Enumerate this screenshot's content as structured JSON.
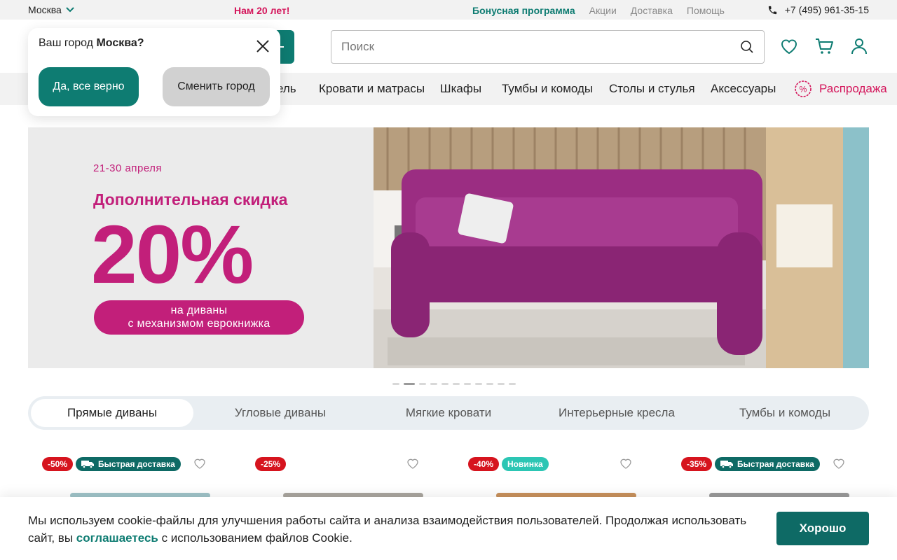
{
  "topbar": {
    "city": "Москва",
    "anniversary": "Нам 20 лет!",
    "links": [
      "Бонусная программа",
      "Акции",
      "Доставка",
      "Помощь"
    ],
    "phone": "+7 (495) 961-35-15"
  },
  "header": {
    "search_placeholder": "Поиск",
    "icons": [
      "heart-icon",
      "cart-icon",
      "user-icon"
    ]
  },
  "nav": {
    "partial_item": "ель",
    "items": [
      "Кровати и матрасы",
      "Шкафы",
      "Тумбы и комоды",
      "Столы и стулья",
      "Аксессуары"
    ],
    "sale": "Распродажа"
  },
  "city_popup": {
    "question": "Ваш город",
    "city": "Москва?",
    "confirm": "Да, все верно",
    "change": "Сменить город"
  },
  "banner": {
    "date": "21-30 апреля",
    "headline": "Дополнительная скидка",
    "percent": "20%",
    "pill_line1": "на диваны",
    "pill_line2": "с механизмом еврокнижка",
    "slides_total": 11,
    "active_slide": 2
  },
  "category_tabs": [
    {
      "label": "Прямые диваны",
      "active": true
    },
    {
      "label": "Угловые диваны",
      "active": false
    },
    {
      "label": "Мягкие кровати",
      "active": false
    },
    {
      "label": "Интерьерные кресла",
      "active": false
    },
    {
      "label": "Тумбы и комоды",
      "active": false
    }
  ],
  "products": [
    {
      "discount": "-50%",
      "tag": "Быстрая доставка",
      "tag_type": "delivery"
    },
    {
      "discount": "-25%",
      "tag": "",
      "tag_type": ""
    },
    {
      "discount": "-40%",
      "tag": "Новинка",
      "tag_type": "new"
    },
    {
      "discount": "-35%",
      "tag": "Быстрая доставка",
      "tag_type": "delivery"
    }
  ],
  "cookie": {
    "text_1": "Мы используем cookie-файлы для улучшения работы сайта и анализа взаимодействия пользователей. Продолжая использовать сайт, вы ",
    "link": "соглашаетесь",
    "text_2": " с использованием файлов Cookie.",
    "button": "Хорошо"
  },
  "colors": {
    "brand": "#0e7c72",
    "accent": "#d4145a",
    "banner_pink": "#c21f7a",
    "discount_red": "#d6141e"
  }
}
